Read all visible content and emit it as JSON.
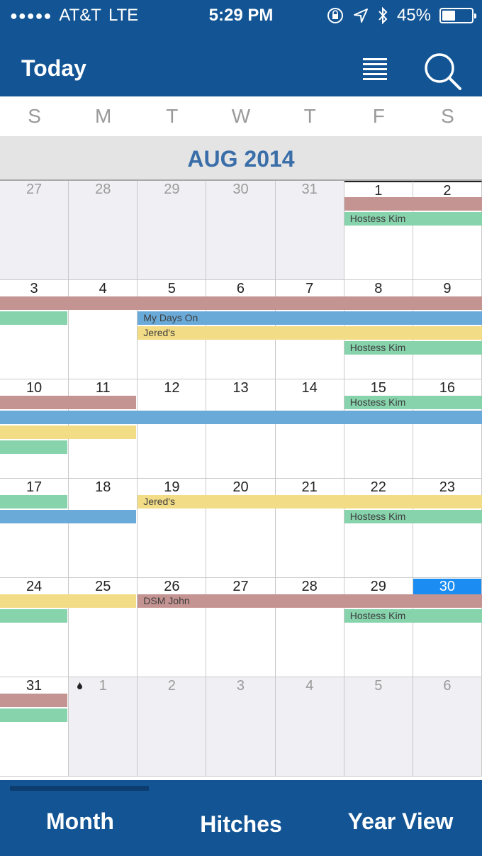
{
  "status_bar": {
    "signal_dots": "●●●●●",
    "carrier": "AT&T",
    "network": "LTE",
    "time": "5:29 PM",
    "battery_text": "45%",
    "battery_level": 0.45
  },
  "nav": {
    "today_label": "Today",
    "list_icon": "list-icon",
    "search_icon": "search-icon"
  },
  "weekdays": [
    "S",
    "M",
    "T",
    "W",
    "T",
    "F",
    "S"
  ],
  "month_title": "AUG 2014",
  "weeks": [
    {
      "days": [
        {
          "num": "27",
          "other": true
        },
        {
          "num": "28",
          "other": true
        },
        {
          "num": "29",
          "other": true
        },
        {
          "num": "30",
          "other": true
        },
        {
          "num": "31",
          "other": true
        },
        {
          "num": "1"
        },
        {
          "num": "2"
        }
      ],
      "events": [
        {
          "row": 0,
          "start": 5,
          "end": 6,
          "color": "red",
          "label": ""
        },
        {
          "row": 1,
          "start": 5,
          "end": 6,
          "color": "green",
          "label": "Hostess Kim"
        }
      ]
    },
    {
      "days": [
        {
          "num": "3"
        },
        {
          "num": "4"
        },
        {
          "num": "5"
        },
        {
          "num": "6"
        },
        {
          "num": "7"
        },
        {
          "num": "8"
        },
        {
          "num": "9"
        }
      ],
      "events": [
        {
          "row": 0,
          "start": 0,
          "end": 6,
          "color": "red",
          "label": ""
        },
        {
          "row": 1,
          "start": 0,
          "end": 0,
          "color": "green",
          "label": ""
        },
        {
          "row": 1,
          "start": 2,
          "end": 6,
          "color": "blue",
          "label": "My Days On"
        },
        {
          "row": 2,
          "start": 2,
          "end": 6,
          "color": "yellow",
          "label": "Jered's"
        },
        {
          "row": 3,
          "start": 5,
          "end": 6,
          "color": "green",
          "label": "Hostess Kim"
        }
      ]
    },
    {
      "days": [
        {
          "num": "10"
        },
        {
          "num": "11"
        },
        {
          "num": "12"
        },
        {
          "num": "13"
        },
        {
          "num": "14"
        },
        {
          "num": "15"
        },
        {
          "num": "16"
        }
      ],
      "events": [
        {
          "row": 0,
          "start": 0,
          "end": 1,
          "color": "red",
          "label": ""
        },
        {
          "row": 0,
          "start": 5,
          "end": 6,
          "color": "green",
          "label": "Hostess Kim"
        },
        {
          "row": 1,
          "start": 0,
          "end": 6,
          "color": "blue",
          "label": ""
        },
        {
          "row": 2,
          "start": 0,
          "end": 1,
          "color": "yellow",
          "label": ""
        },
        {
          "row": 3,
          "start": 0,
          "end": 0,
          "color": "green",
          "label": ""
        }
      ]
    },
    {
      "days": [
        {
          "num": "17"
        },
        {
          "num": "18"
        },
        {
          "num": "19"
        },
        {
          "num": "20"
        },
        {
          "num": "21"
        },
        {
          "num": "22"
        },
        {
          "num": "23"
        }
      ],
      "events": [
        {
          "row": 0,
          "start": 0,
          "end": 0,
          "color": "green",
          "label": ""
        },
        {
          "row": 0,
          "start": 2,
          "end": 6,
          "color": "yellow",
          "label": "Jered's"
        },
        {
          "row": 1,
          "start": 0,
          "end": 1,
          "color": "blue",
          "label": ""
        },
        {
          "row": 1,
          "start": 5,
          "end": 6,
          "color": "green",
          "label": "Hostess Kim"
        }
      ]
    },
    {
      "days": [
        {
          "num": "24"
        },
        {
          "num": "25"
        },
        {
          "num": "26"
        },
        {
          "num": "27"
        },
        {
          "num": "28"
        },
        {
          "num": "29"
        },
        {
          "num": "30",
          "selected": true
        }
      ],
      "events": [
        {
          "row": 0,
          "start": 0,
          "end": 1,
          "color": "yellow",
          "label": ""
        },
        {
          "row": 0,
          "start": 2,
          "end": 6,
          "color": "red",
          "label": "DSM John"
        },
        {
          "row": 1,
          "start": 0,
          "end": 0,
          "color": "green",
          "label": ""
        },
        {
          "row": 1,
          "start": 5,
          "end": 6,
          "color": "green",
          "label": "Hostess Kim"
        }
      ]
    },
    {
      "days": [
        {
          "num": "31"
        },
        {
          "num": "1",
          "other": true,
          "drop": true
        },
        {
          "num": "2",
          "other": true
        },
        {
          "num": "3",
          "other": true
        },
        {
          "num": "4",
          "other": true
        },
        {
          "num": "5",
          "other": true
        },
        {
          "num": "6",
          "other": true
        }
      ],
      "events": [
        {
          "row": 0,
          "start": 0,
          "end": 0,
          "color": "red",
          "label": ""
        },
        {
          "row": 1,
          "start": 0,
          "end": 0,
          "color": "green",
          "label": ""
        }
      ]
    }
  ],
  "tabs": {
    "month": "Month",
    "hitches": "Hitches",
    "year_view": "Year View"
  }
}
